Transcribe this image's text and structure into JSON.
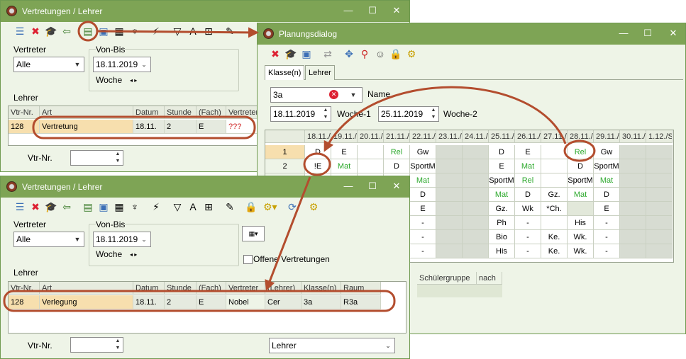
{
  "win_back": {
    "title": "Vertretungen / Lehrer",
    "vertreter_label": "Vertreter",
    "vertreter_value": "Alle",
    "von_bis_label": "Von-Bis",
    "date": "18.11.2019",
    "woche_label": "Woche",
    "lehrer_label": "Lehrer",
    "vtr_nr_label": "Vtr-Nr.",
    "columns": [
      "Vtr-Nr.",
      "Art",
      "Datum",
      "Stunde",
      "(Fach)",
      "Vertreter"
    ],
    "row": [
      "128",
      "Vertretung",
      "18.11.",
      "2",
      "E",
      "???"
    ]
  },
  "win_plan": {
    "title": "Planungsdialog",
    "tabs": [
      "Klasse(n)",
      "Lehrer"
    ],
    "klasse_value": "3a",
    "name_label": "Name",
    "date1": "18.11.2019",
    "woche1_label": "Woche-1",
    "date2": "25.11.2019",
    "woche2_label": "Woche-2",
    "day_headers": [
      "18.11./",
      "19.11./",
      "20.11./",
      "21.11./",
      "22.11./",
      "23.11./",
      "24.11./",
      "25.11./",
      "26.11./",
      "27.11./",
      "28.11./",
      "29.11./",
      "30.11./",
      "1.12./S"
    ],
    "row_numbers": [
      "1",
      "2"
    ],
    "grid": [
      [
        "D",
        "E",
        "",
        "Rel",
        "Gw",
        "",
        "",
        "D",
        "E",
        "",
        "Rel",
        "Gw",
        "",
        ""
      ],
      [
        "!E",
        "Mat",
        "",
        "D",
        "SportM",
        "",
        "",
        "E",
        "Mat",
        "",
        "D",
        "SportM",
        "",
        ""
      ],
      [
        "",
        "",
        "",
        "",
        "Mat",
        "",
        "",
        "SportM",
        "Rel",
        "",
        "SportM",
        "Mat",
        "",
        ""
      ],
      [
        "",
        "",
        "",
        "",
        "D",
        "",
        "",
        "Mat",
        "D",
        "Gz.",
        "Mat",
        "D",
        "",
        ""
      ],
      [
        "",
        "",
        "",
        "",
        "E",
        "",
        "",
        "Gz.",
        "Wk",
        "*Ch.",
        "",
        "E",
        "",
        ""
      ],
      [
        "",
        "",
        "",
        "",
        "-",
        "",
        "",
        "Ph",
        "-",
        "",
        "His",
        "-",
        "",
        ""
      ],
      [
        "",
        "",
        "",
        "",
        "-",
        "",
        "",
        "Bio",
        "-",
        "Ke.",
        "Wk.",
        "-",
        "",
        ""
      ],
      [
        "",
        "",
        "",
        "",
        "-",
        "",
        "",
        "His",
        "-",
        "Ke.",
        "Wk.",
        "-",
        "",
        ""
      ]
    ],
    "lower_headers": [
      "Schülergruppe",
      "nach"
    ]
  },
  "win_front": {
    "title": "Vertretungen / Lehrer",
    "vertreter_label": "Vertreter",
    "vertreter_value": "Alle",
    "von_bis_label": "Von-Bis",
    "date": "18.11.2019",
    "woche_label": "Woche",
    "offene_label": "Offene Vertretungen",
    "lehrer_label": "Lehrer",
    "columns": [
      "Vtr-Nr.",
      "Art",
      "Datum",
      "Stunde",
      "(Fach)",
      "Vertreter",
      "(Lehrer)",
      "Klasse(n)",
      "Raum"
    ],
    "row": [
      "128",
      "Verlegung",
      "18.11.",
      "2",
      "E",
      "Nobel",
      "Cer",
      "3a",
      "R3a"
    ],
    "vtr_nr_label": "Vtr-Nr.",
    "lehrer_dropdown": "Lehrer"
  },
  "colors": {
    "accent": "#7ea455",
    "annotation": "#b34d2e",
    "highlight_row": "#f7dfae",
    "green_text": "#2ba82b"
  }
}
